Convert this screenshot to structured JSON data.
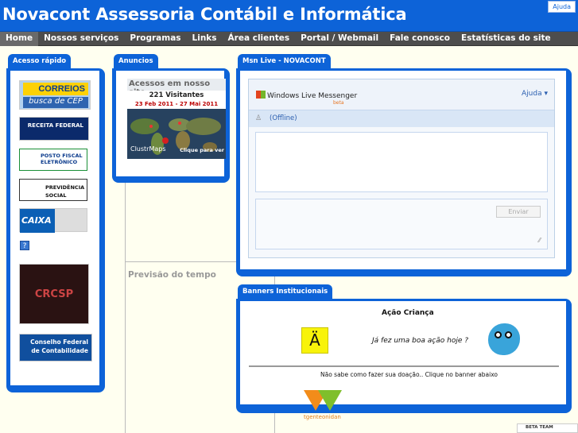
{
  "header": {
    "title": "Novacont Assessoria Contábil e Informática",
    "help": "Ajuda"
  },
  "nav": [
    {
      "label": "Home",
      "active": true
    },
    {
      "label": "Nossos serviços"
    },
    {
      "label": "Programas"
    },
    {
      "label": "Links"
    },
    {
      "label": "Área clientes"
    },
    {
      "label": "Portal / Webmail"
    },
    {
      "label": "Fale conosco"
    },
    {
      "label": "Estatísticas do site"
    }
  ],
  "acesso": {
    "tab": "Acesso rápido",
    "correios_top": "CORREIOS",
    "correios_bottom": "busca de CEP",
    "receita": "RECEITA FEDERAL",
    "posto": "POSTO FISCAL ELETRÔNICO",
    "previdencia": "PREVIDÊNCIA SOCIAL",
    "caixa": "CAIXA",
    "crcsp": "CRCSP",
    "cfc": "Conselho Federal de Contabilidade"
  },
  "anuncios": {
    "tab": "Anuncios",
    "clustr_title": "Acessos em nosso site",
    "visitors": "221 Visitantes",
    "dates": "23 Feb 2011 - 27 Mai 2011",
    "clustr_logo": "ClustrMaps",
    "clustr_link": "Clique para ver",
    "tempo": "Previsão do tempo"
  },
  "msn": {
    "tab": "Msn Live - NOVACONT",
    "logo": "Windows Live Messenger",
    "beta": "beta",
    "help": "Ajuda",
    "status": "(Offline)",
    "send": "Enviar"
  },
  "banners": {
    "tab": "Banners Institucionais",
    "title": "Ação Criança",
    "question": "Já fez uma boa ação hoje ?",
    "donation": "Não sabe como fazer sua doação.. Clique no banner abaixo",
    "logo_text": "tgenteonidan",
    "beta_team": "BETA TEAM"
  },
  "colors": {
    "accent": "#0d63d8",
    "nav_bg": "#4d4d4d",
    "page_bg": "#fffff0"
  }
}
